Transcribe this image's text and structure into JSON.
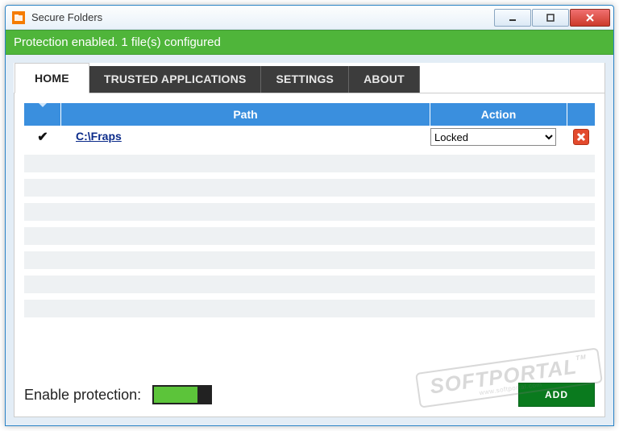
{
  "window": {
    "title": "Secure Folders"
  },
  "status": {
    "text": "Protection enabled. 1 file(s) configured"
  },
  "tabs": [
    {
      "label": "HOME",
      "active": true
    },
    {
      "label": "TRUSTED APPLICATIONS",
      "active": false
    },
    {
      "label": "SETTINGS",
      "active": false
    },
    {
      "label": "ABOUT",
      "active": false
    }
  ],
  "grid": {
    "headers": {
      "path": "Path",
      "action": "Action"
    },
    "rows": [
      {
        "checked": true,
        "path": "C:\\Fraps",
        "action": "Locked"
      }
    ],
    "action_options": [
      "Locked"
    ]
  },
  "footer": {
    "label": "Enable protection:",
    "toggle_on": true,
    "add_label": "ADD"
  },
  "watermark": {
    "main": "SOFTPORTAL",
    "sub": "www.softportal.com",
    "tm": "TM"
  }
}
